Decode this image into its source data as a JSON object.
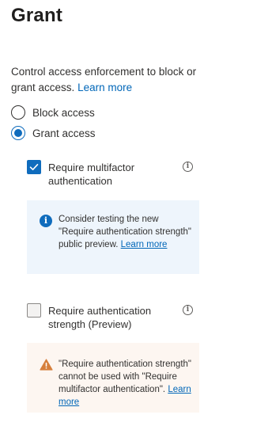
{
  "header": {
    "title": "Grant"
  },
  "description": {
    "text": "Control access enforcement to block or grant access.",
    "link": "Learn more"
  },
  "access_mode": {
    "options": [
      {
        "label": "Block access",
        "selected": false
      },
      {
        "label": "Grant access",
        "selected": true
      }
    ]
  },
  "controls": [
    {
      "label": "Require multifactor authentication",
      "checked": true
    },
    {
      "label": "Require authentication strength (Preview)",
      "checked": false
    }
  ],
  "info_notice": {
    "text": "Consider testing the new \"Require authentication strength\" public preview.",
    "link": "Learn more"
  },
  "warning_notice": {
    "text": "\"Require authentication strength\" cannot be used with \"Require multifactor authentication\".",
    "link": "Learn more"
  },
  "icons": {
    "info": "info-circle-icon",
    "warning": "warning-triangle-icon",
    "check": "checkmark-icon"
  },
  "colors": {
    "accent": "#0f6cbd",
    "link": "#0066b8",
    "info_bg": "#eef5fc",
    "warning_bg": "#fdf6f1",
    "warning_icon": "#d67f3c"
  }
}
